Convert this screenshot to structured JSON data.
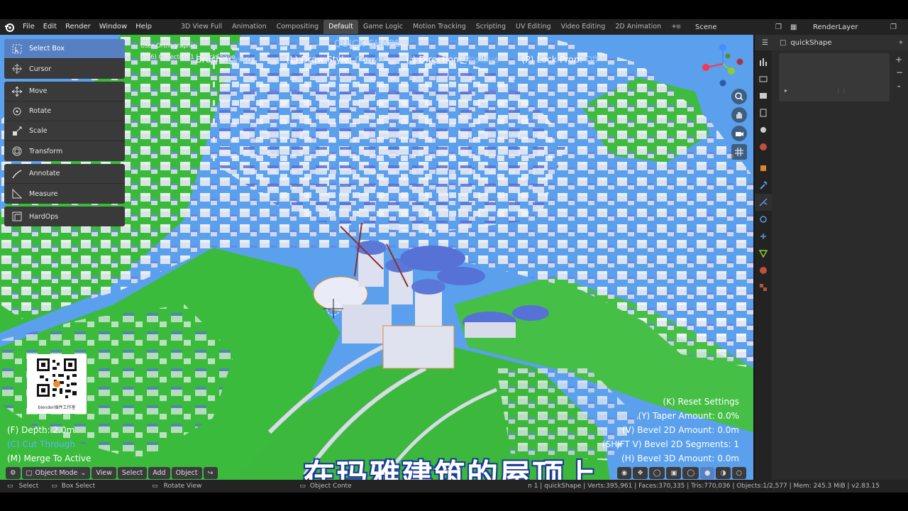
{
  "menubar": {
    "items": [
      "File",
      "Edit",
      "Render",
      "Window",
      "Help"
    ],
    "workspace_tabs": [
      "3D View Full",
      "Animation",
      "Compositing",
      "Default",
      "Game Logic",
      "Motion Tracking",
      "Scripting",
      "UV Editing",
      "Video Editing",
      "2D Animation"
    ],
    "active_tab": "Default",
    "add_tab": "+",
    "scene": "Scene",
    "render_layer": "RenderLayer"
  },
  "toolbar": {
    "tools": [
      "Select Box",
      "Cursor",
      "Move",
      "Rotate",
      "Scale",
      "Transform",
      "Annotate",
      "Measure",
      "HardOps"
    ]
  },
  "viewport": {
    "view_name": "User Orthographic",
    "collection": "(146) Collection 1 | quickShape",
    "quick_shape": {
      "title": "QUICK SHAPE",
      "brush_label": "Brush:",
      "brush_value": "Lasso",
      "draw_style_label": "(L) Draw Style:",
      "draw_style_value": "Corner",
      "direction_label": "(;) Direction:",
      "direction_value": "Positive",
      "lock_prop_label": "(P) Lock Prop:",
      "lock_prop_value": "Off"
    },
    "overlay_left": {
      "depth": "(F) Depth: 2.0m",
      "cut_through": "(C) Cut Through",
      "merge": "(M) Merge To Active"
    },
    "overlay_right": {
      "reset": "(K) Reset Settings",
      "taper": "(Y) Taper Amount: 0.0%",
      "bevel2d": "(V) Bevel 2D Amount: 0.0m",
      "bevel2d_seg": "(SHIFT V) Bevel 2D Segments: 1",
      "bevel3d": "(H) Bevel 3D Amount: 0.0m"
    },
    "header": {
      "mode": "Object Mode",
      "view": "View",
      "select": "Select",
      "add": "Add",
      "object": "Object"
    },
    "subtitle": "在玛雅建筑的屋顶上",
    "qr_caption": "blender插件工作室"
  },
  "statusbar": {
    "select": "Select",
    "box_select": "Box Select",
    "rotate_view": "Rotate View",
    "object_context": "Object Conte",
    "stats": "n 1 | quickShape | Verts:395,961 | Faces:370,335 | Tris:770,036 | Objects:1/2,577 | Mem: 245.3 MiB | v2.83.15"
  },
  "properties": {
    "object_name": "quickShape"
  }
}
